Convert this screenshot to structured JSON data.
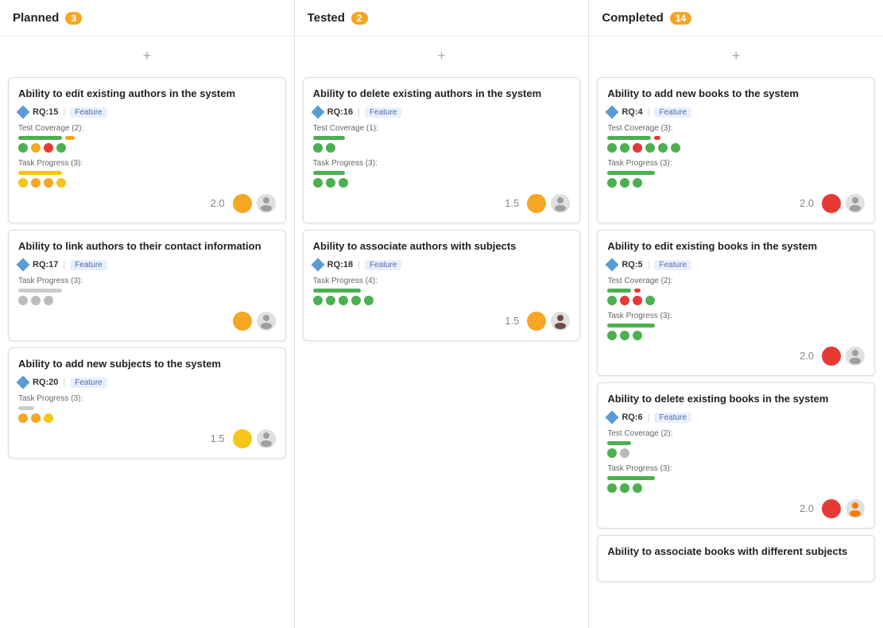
{
  "columns": [
    {
      "id": "planned",
      "title": "Planned",
      "count": "3",
      "cards": [
        {
          "id": "card-1",
          "title": "Ability to edit existing authors in the system",
          "rq": "RQ:15",
          "badge": "Feature",
          "testCoverage": {
            "label": "Test Coverage (2):",
            "bars": [
              "green-long",
              "orange-short",
              "red-dot",
              "green-dot"
            ],
            "dots": [
              "green",
              "orange",
              "red",
              "green"
            ]
          },
          "taskProgress": {
            "label": "Task Progress (3):",
            "bars": [
              "yellow-long"
            ],
            "dots": [
              "yellow",
              "orange",
              "orange",
              "yellow"
            ]
          },
          "score": "2.0",
          "avatars": [
            "orange",
            "person"
          ]
        },
        {
          "id": "card-2",
          "title": "Ability to link authors to their contact information",
          "rq": "RQ:17",
          "badge": "Feature",
          "taskProgress": {
            "label": "Task Progress (3):",
            "bars": [
              "gray-long"
            ],
            "dots": [
              "gray",
              "gray",
              "gray"
            ]
          },
          "score": null,
          "avatars": [
            "orange",
            "person"
          ]
        },
        {
          "id": "card-3",
          "title": "Ability to add new subjects to the system",
          "rq": "RQ:20",
          "badge": "Feature",
          "taskProgress": {
            "label": "Task Progress (3):",
            "bars": [
              "gray-short"
            ],
            "dots": [
              "orange",
              "orange",
              "yellow"
            ]
          },
          "score": "1.5",
          "avatars": [
            "yellow",
            "person"
          ]
        }
      ]
    },
    {
      "id": "tested",
      "title": "Tested",
      "count": "2",
      "cards": [
        {
          "id": "card-4",
          "title": "Ability to delete existing authors in the system",
          "rq": "RQ:16",
          "badge": "Feature",
          "testCoverage": {
            "label": "Test Coverage (1):",
            "bars": [
              "green-mid",
              "green-dot"
            ],
            "dots": [
              "green",
              "green"
            ]
          },
          "taskProgress": {
            "label": "Task Progress (3):",
            "bars": [
              "green-mid"
            ],
            "dots": [
              "green",
              "green",
              "green"
            ]
          },
          "score": "1.5",
          "avatars": [
            "orange",
            "person"
          ]
        },
        {
          "id": "card-5",
          "title": "Ability to associate authors with subjects",
          "rq": "RQ:18",
          "badge": "Feature",
          "taskProgress": {
            "label": "Task Progress (4):",
            "bars": [
              "green-long"
            ],
            "dots": [
              "green",
              "green",
              "green",
              "green",
              "green"
            ]
          },
          "score": "1.5",
          "avatars": [
            "orange",
            "person2"
          ]
        }
      ]
    },
    {
      "id": "completed",
      "title": "Completed",
      "count": "14",
      "cards": [
        {
          "id": "card-6",
          "title": "Ability to add new books to the system",
          "rq": "RQ:4",
          "badge": "Feature",
          "testCoverage": {
            "label": "Test Coverage (3):",
            "dots": [
              "green",
              "green",
              "red",
              "green",
              "green",
              "green"
            ]
          },
          "taskProgress": {
            "label": "Task Progress (3):",
            "bars": [
              "green-long"
            ],
            "dots": [
              "green",
              "green",
              "green"
            ]
          },
          "score": "2.0",
          "avatars": [
            "red",
            "person"
          ]
        },
        {
          "id": "card-7",
          "title": "Ability to edit existing books in the system",
          "rq": "RQ:5",
          "badge": "Feature",
          "testCoverage": {
            "label": "Test Coverage (2):",
            "dots": [
              "green",
              "red",
              "red",
              "green"
            ]
          },
          "taskProgress": {
            "label": "Task Progress (3):",
            "dots": [
              "green",
              "green",
              "green"
            ]
          },
          "score": "2.0",
          "avatars": [
            "red",
            "person"
          ]
        },
        {
          "id": "card-8",
          "title": "Ability to delete existing books in the system",
          "rq": "RQ:6",
          "badge": "Feature",
          "testCoverage": {
            "label": "Test Coverage (2):",
            "dots": [
              "green",
              "gray"
            ]
          },
          "taskProgress": {
            "label": "Task Progress (3):",
            "dots": [
              "green",
              "green",
              "green"
            ]
          },
          "score": "2.0",
          "avatars": [
            "red",
            "person2"
          ]
        },
        {
          "id": "card-9",
          "title": "Ability to associate books with different subjects",
          "rq": null,
          "badge": null,
          "testCoverage": null,
          "taskProgress": null,
          "score": null,
          "avatars": []
        }
      ]
    }
  ],
  "addButtonLabel": "+",
  "featureLabel": "Feature",
  "dividerLabel": "|"
}
